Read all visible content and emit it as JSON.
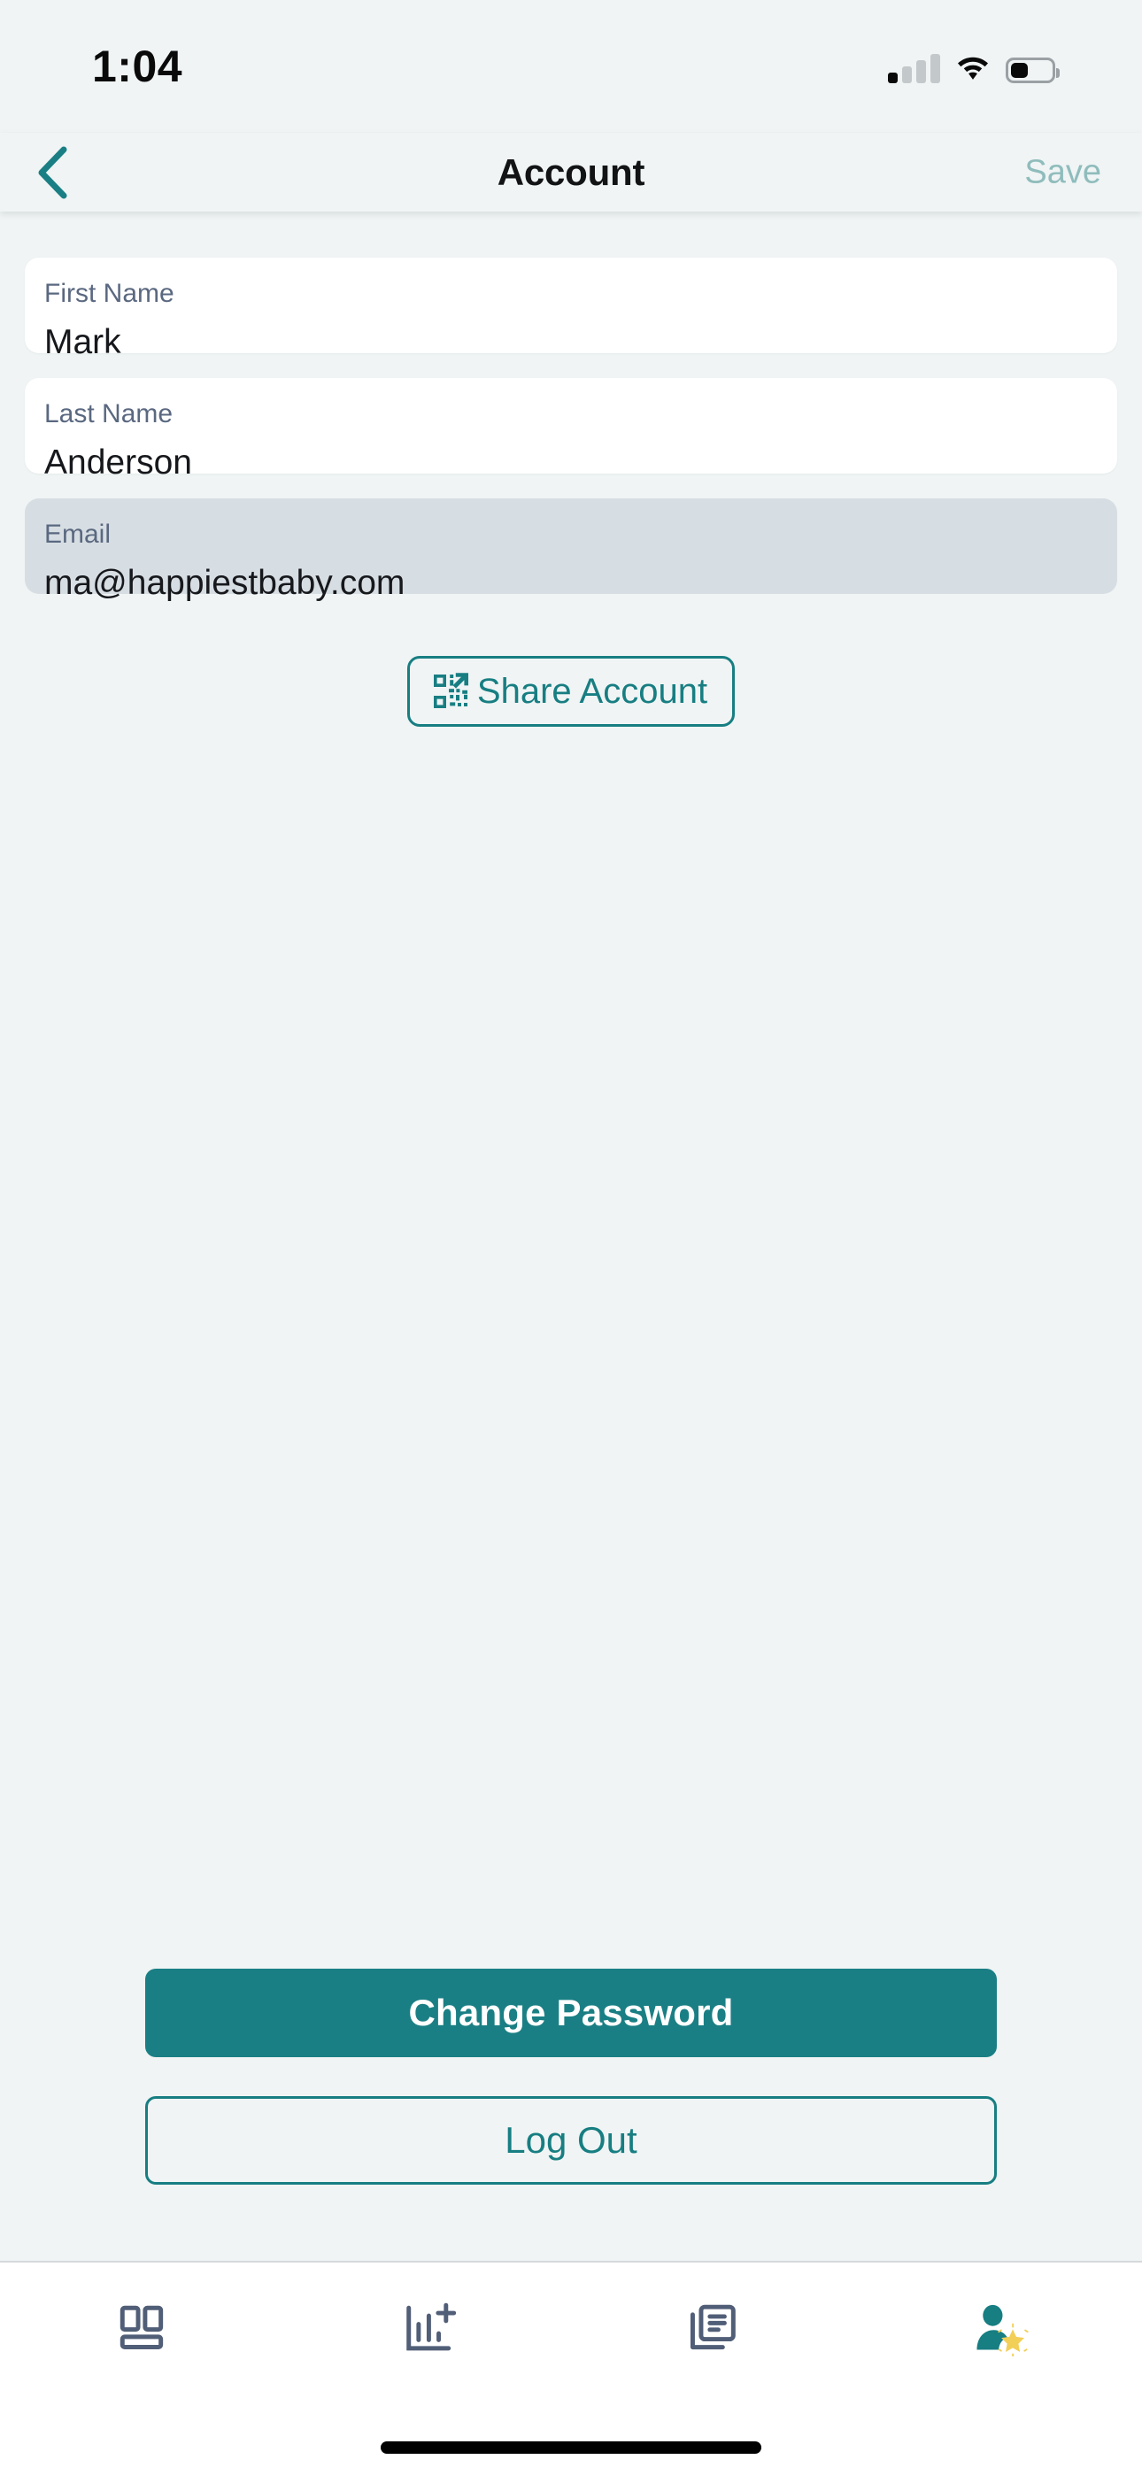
{
  "status_bar": {
    "time": "1:04",
    "signal_icon": "cellular-signal-icon",
    "signal_bars_filled": 1,
    "signal_bars_total": 4,
    "wifi_icon": "wifi-icon",
    "battery_icon": "battery-icon",
    "battery_level_percent": 38
  },
  "navbar": {
    "back_icon": "chevron-left-icon",
    "title": "Account",
    "save_label": "Save",
    "save_enabled": false
  },
  "form": {
    "fields": [
      {
        "name": "first-name",
        "label": "First Name",
        "value": "Mark",
        "placeholder": "First Name",
        "disabled": false
      },
      {
        "name": "last-name",
        "label": "Last Name",
        "value": "Anderson",
        "placeholder": "Last Name",
        "disabled": false
      },
      {
        "name": "email",
        "label": "Email",
        "value": "ma@happiestbaby.com",
        "placeholder": "Email",
        "disabled": true
      }
    ]
  },
  "share": {
    "label": "Share Account",
    "icon": "qr-code-share-icon"
  },
  "actions": {
    "change_password_label": "Change Password",
    "log_out_label": "Log Out"
  },
  "tabbar": {
    "items": [
      {
        "name": "dashboard",
        "icon": "dashboard-layout-icon",
        "active": false
      },
      {
        "name": "activity",
        "icon": "bar-chart-plus-icon",
        "active": false
      },
      {
        "name": "articles",
        "icon": "documents-icon",
        "active": false
      },
      {
        "name": "profile",
        "icon": "profile-star-icon",
        "active": true
      }
    ]
  },
  "colors": {
    "background": "#F0F4F4",
    "accent_teal": "#1A7F84",
    "accent_teal_muted": "#8FBCBC",
    "card_white": "#FFFFFF",
    "disabled_field": "#D7DEE3",
    "label_slate": "#5A6880",
    "tab_inactive": "#515E77",
    "star_gold": "#F2CF57"
  }
}
